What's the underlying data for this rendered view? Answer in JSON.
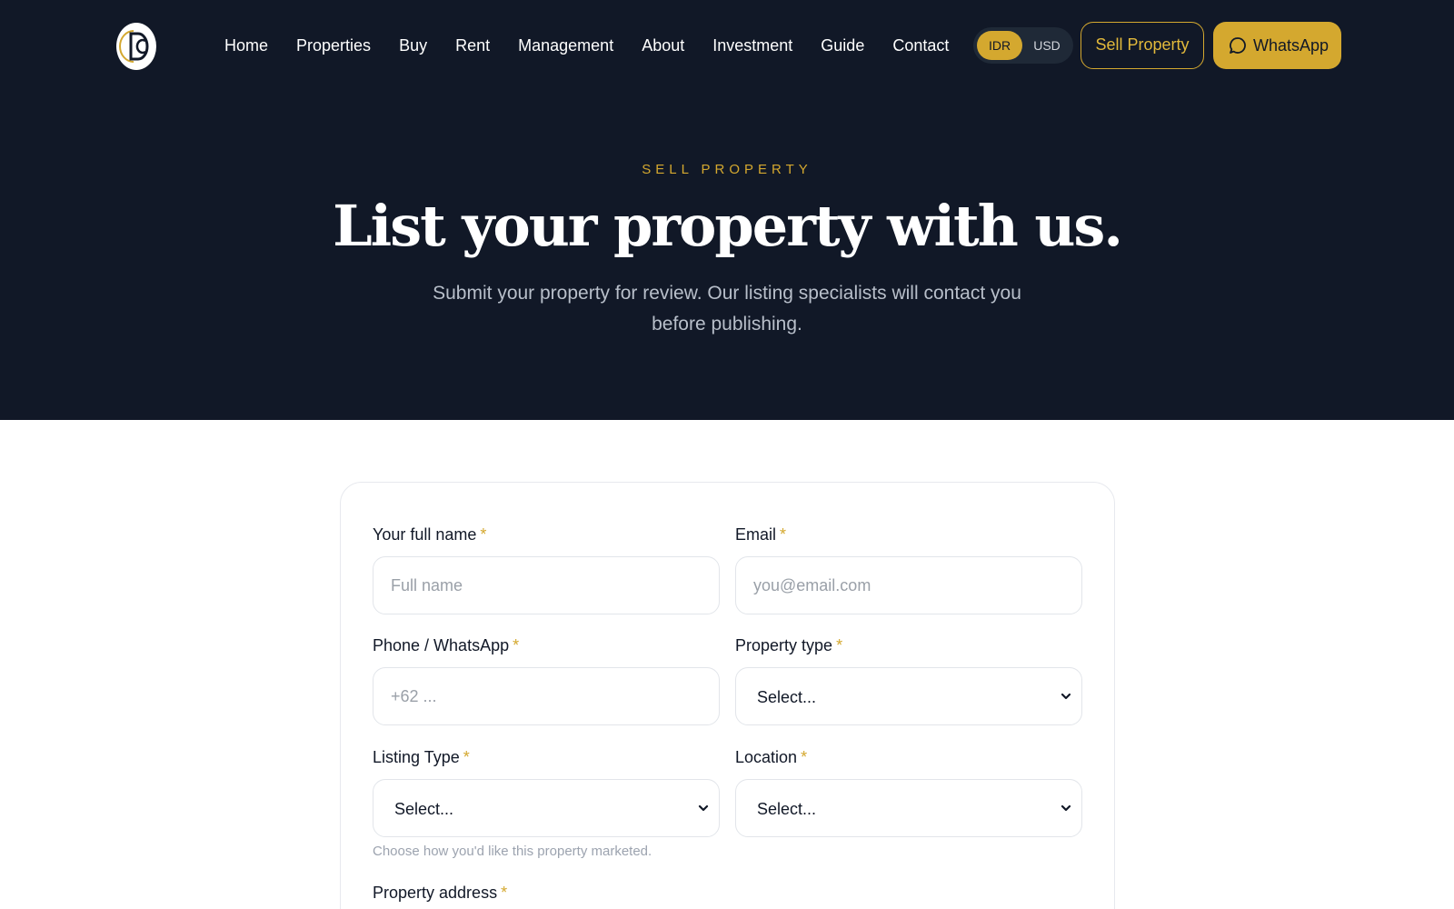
{
  "nav": {
    "logo_name": "brand-logo",
    "links": [
      {
        "label": "Home"
      },
      {
        "label": "Properties"
      },
      {
        "label": "Buy"
      },
      {
        "label": "Rent"
      },
      {
        "label": "Management"
      },
      {
        "label": "About"
      },
      {
        "label": "Investment"
      },
      {
        "label": "Guide"
      },
      {
        "label": "Contact"
      }
    ],
    "currency": {
      "options": [
        "IDR",
        "USD"
      ],
      "selected": "IDR"
    },
    "sell_label": "Sell Property",
    "whatsapp_label": "WhatsApp",
    "whatsapp_icon": "chat-bubble-icon"
  },
  "hero": {
    "eyebrow": "SELL PROPERTY",
    "title": "List your property with us.",
    "subtitle": "Submit your property for review. Our listing specialists will contact you before publishing."
  },
  "form": {
    "required_mark": "*",
    "full_name": {
      "label": "Your full name",
      "placeholder": "Full name",
      "value": ""
    },
    "email": {
      "label": "Email",
      "placeholder": "you@email.com",
      "value": ""
    },
    "phone": {
      "label": "Phone / WhatsApp",
      "placeholder": "+62 ...",
      "value": ""
    },
    "property_type": {
      "label": "Property type",
      "selected": "Select..."
    },
    "listing_type": {
      "label": "Listing Type",
      "selected": "Select...",
      "hint": "Choose how you'd like this property marketed."
    },
    "location": {
      "label": "Location",
      "selected": "Select..."
    },
    "address": {
      "label": "Property address"
    }
  },
  "colors": {
    "navy": "#111827",
    "gold": "#d4a82f",
    "white": "#ffffff"
  }
}
